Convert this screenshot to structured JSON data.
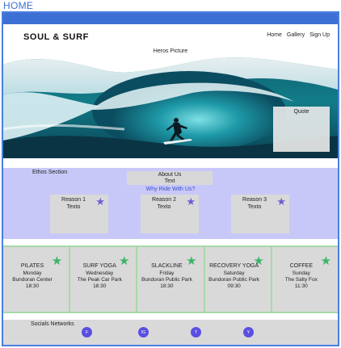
{
  "page_label": "HOME",
  "header": {
    "brand": "SOUL & SURF",
    "nav": [
      "Home",
      "Gallery",
      "Sign Up"
    ]
  },
  "hero": {
    "label": "Heros Picture",
    "quote": "Quote"
  },
  "ethos": {
    "title": "Ethos Section",
    "about_title": "About Us",
    "about_text": "Text",
    "why": "Why Ride With Us?",
    "reasons": [
      {
        "title": "Reason 1",
        "text": "Texto"
      },
      {
        "title": "Reason 2",
        "text": "Texto"
      },
      {
        "title": "Reason 3",
        "text": "Texto"
      }
    ]
  },
  "classes": [
    {
      "name": "PILATES",
      "day": "Monday",
      "place": "Bundoran Center",
      "time": "18:30"
    },
    {
      "name": "SURF YOGA",
      "day": "Wednesday",
      "place": "The Peak Car Park",
      "time": "18:30"
    },
    {
      "name": "SLACKLINE",
      "day": "Friday",
      "place": "Bundoran Public Park",
      "time": "18:30"
    },
    {
      "name": "RECOVERY YOGA",
      "day": "Saturday",
      "place": "Bundoran Public Park",
      "time": "09:30"
    },
    {
      "name": "COFFEE",
      "day": "Sunday",
      "place": "The Salty Fox",
      "time": "11:30"
    }
  ],
  "socials": {
    "title": "Socials Networks",
    "links": [
      {
        "label": "F",
        "icon": "facebook-icon"
      },
      {
        "label": "IG",
        "icon": "instagram-icon"
      },
      {
        "label": "T",
        "icon": "twitter-icon"
      },
      {
        "label": "Y",
        "icon": "youtube-icon"
      }
    ]
  },
  "colors": {
    "topbar": "#3d6fd4",
    "ethos_bg": "#c8c8f8",
    "classes_bg": "#a8d8a8",
    "reason_star": "#6a5ed8",
    "class_star": "#3cb46a",
    "social_button": "#5a4fe0"
  }
}
